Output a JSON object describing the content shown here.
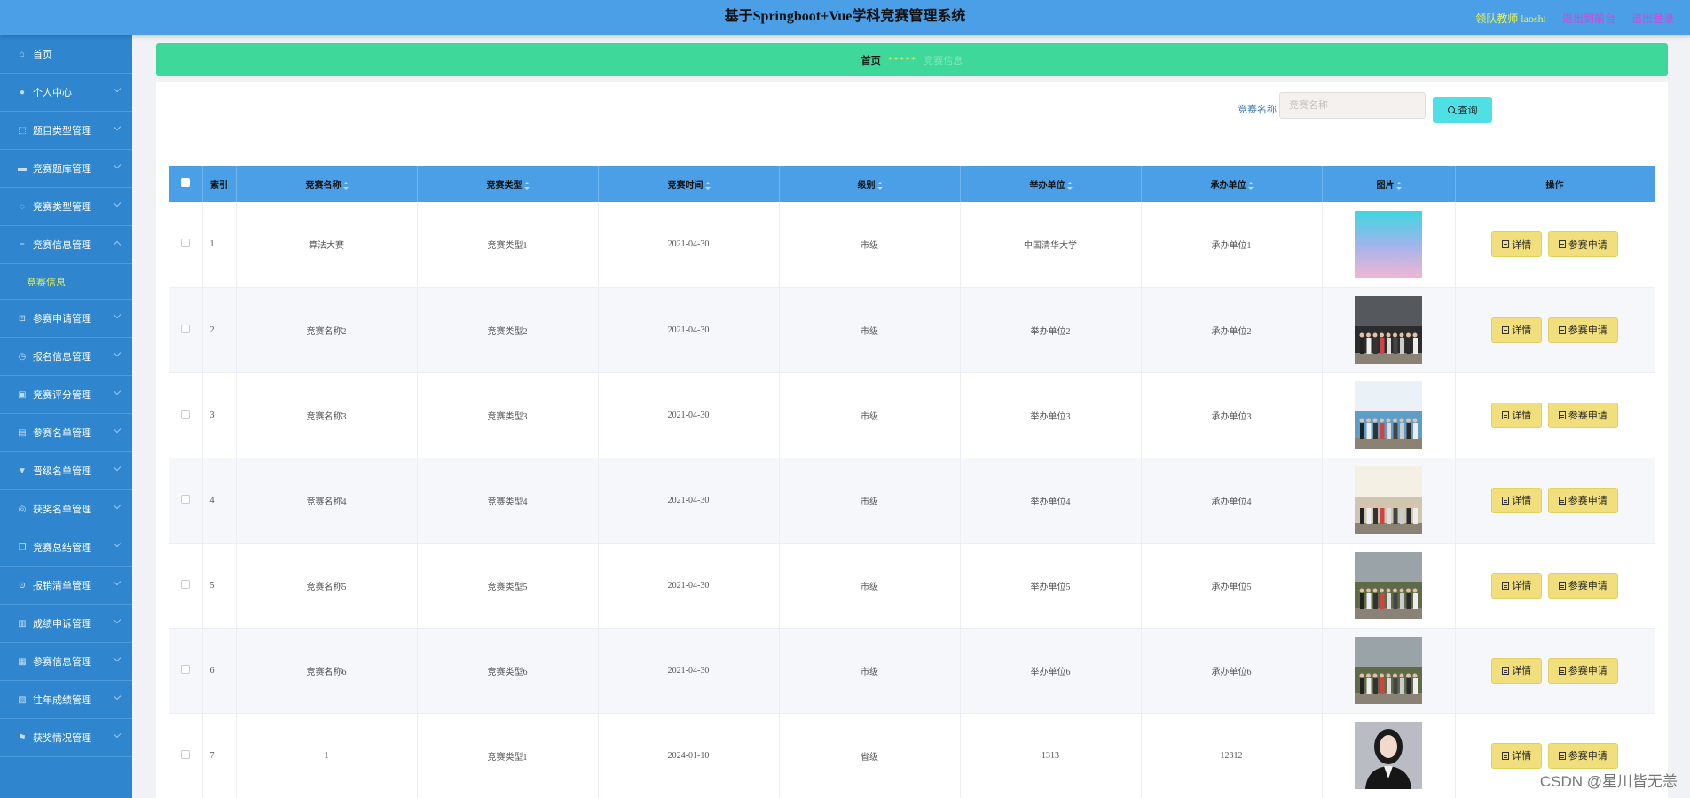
{
  "header": {
    "title": "基于Springboot+Vue学科竞赛管理系统",
    "user": "领队教师 laoshi",
    "back_to_front": "退出到前台",
    "logout": "退出登录"
  },
  "sidebar": {
    "items": [
      {
        "label": "首页",
        "icon": "home-icon"
      },
      {
        "label": "个人中心",
        "icon": "user-icon"
      },
      {
        "label": "题目类型管理",
        "icon": "frame-icon"
      },
      {
        "label": "竞赛题库管理",
        "icon": "ticket-icon"
      },
      {
        "label": "竞赛类型管理",
        "icon": "circle-icon"
      },
      {
        "label": "竞赛信息管理",
        "icon": "menu-icon",
        "expanded": true,
        "sub": "竞赛信息"
      },
      {
        "label": "参赛申请管理",
        "icon": "crop-icon"
      },
      {
        "label": "报名信息管理",
        "icon": "clock-icon"
      },
      {
        "label": "竞赛评分管理",
        "icon": "box-icon"
      },
      {
        "label": "参赛名单管理",
        "icon": "briefcase-icon"
      },
      {
        "label": "晋级名单管理",
        "icon": "shield-icon"
      },
      {
        "label": "获奖名单管理",
        "icon": "medal-icon"
      },
      {
        "label": "竞赛总结管理",
        "icon": "copy-icon"
      },
      {
        "label": "报销清单管理",
        "icon": "compass-icon"
      },
      {
        "label": "成绩申诉管理",
        "icon": "chart-icon"
      },
      {
        "label": "参赛信息管理",
        "icon": "stack-icon"
      },
      {
        "label": "往年成绩管理",
        "icon": "table-icon"
      },
      {
        "label": "获奖情况管理",
        "icon": "flag-icon"
      }
    ]
  },
  "breadcrumb": {
    "home": "首页",
    "separator": "*****",
    "current": "竞赛信息"
  },
  "search": {
    "label": "竞赛名称",
    "placeholder": "竞赛名称",
    "button": "查询"
  },
  "table": {
    "headers": {
      "index": "索引",
      "name": "竞赛名称",
      "type": "竞赛类型",
      "time": "竞赛时间",
      "level": "级别",
      "host": "举办单位",
      "organizer": "承办单位",
      "image": "图片",
      "action": "操作"
    },
    "rows": [
      {
        "index": "1",
        "name": "算法大赛",
        "type": "竞赛类型1",
        "time": "2021-04-30",
        "level": "市级",
        "host": "中国清华大学",
        "organizer": "承办单位1",
        "img": "gradient"
      },
      {
        "index": "2",
        "name": "竞赛名称2",
        "type": "竞赛类型2",
        "time": "2021-04-30",
        "level": "市级",
        "host": "举办单位2",
        "organizer": "承办单位2",
        "img": "group-dark"
      },
      {
        "index": "3",
        "name": "竞赛名称3",
        "type": "竞赛类型3",
        "time": "2021-04-30",
        "level": "市级",
        "host": "举办单位3",
        "organizer": "承办单位3",
        "img": "group-stage"
      },
      {
        "index": "4",
        "name": "竞赛名称4",
        "type": "竞赛类型4",
        "time": "2021-04-30",
        "level": "市级",
        "host": "举办单位4",
        "organizer": "承办单位4",
        "img": "group-banner"
      },
      {
        "index": "5",
        "name": "竞赛名称5",
        "type": "竞赛类型5",
        "time": "2021-04-30",
        "level": "市级",
        "host": "举办单位5",
        "organizer": "承办单位5",
        "img": "group-outdoor"
      },
      {
        "index": "6",
        "name": "竞赛名称6",
        "type": "竞赛类型6",
        "time": "2021-04-30",
        "level": "市级",
        "host": "举办单位6",
        "organizer": "承办单位6",
        "img": "group-outdoor"
      },
      {
        "index": "7",
        "name": "1",
        "type": "竞赛类型1",
        "time": "2024-01-10",
        "level": "省级",
        "host": "1313",
        "organizer": "12312",
        "img": "portrait"
      }
    ],
    "detail_btn": "详情",
    "apply_btn": "参赛申请"
  },
  "watermark": "CSDN @星川皆无恙",
  "colors": {
    "header": "#4a9fe6",
    "sidebar": "#2f86cf",
    "breadcrumb": "#3ed99a",
    "action_button": "#f0df7c",
    "search_button": "#4ee0e4"
  }
}
